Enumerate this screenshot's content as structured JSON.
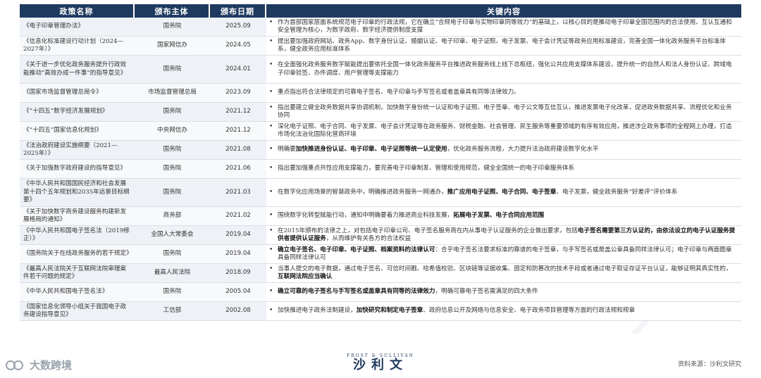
{
  "header": {
    "col_name": "政策名称",
    "col_issuer": "颁布主体",
    "col_date": "颁布日期",
    "col_content": "关键内容"
  },
  "rows": [
    {
      "name": "《电子印章管理办法》",
      "issuer": "国务院",
      "date": "2025.09",
      "content": [
        {
          "t": "作为首部国家层面系统规范电子印章的行政法规，它在确立“合规电子印章与实物印章同等效力”的基础上，以核心目的是推动电子印章全国范围内的合法使用、互认互通和安全管理为核心，为数字政府、数字经济提供制度支撑"
        }
      ]
    },
    {
      "name": "《信息化标准建设行动计划（2024—2027年）》",
      "issuer": "国家网信办",
      "date": "2024.05",
      "content": [
        {
          "t": "提出要加强政府网站、政务App、数字身份认证、婚姻认证、电子印章、电子证照、电子发票、电子会计凭证等政务应用标准建设，完善全国一体化政务服务平台标准体系，健全政务应用标准体系"
        }
      ]
    },
    {
      "name": "《关于进一步优化政务服务提升行政效能推动“高效办成一件事”的指导意见》",
      "issuer": "国务院",
      "date": "2024.01",
      "content": [
        {
          "t": "在全面强化政务服务数字赋能提出要依托全国一体化政务服务平台推进政务服务线上线下总枢纽，强化公共应用支撑体系建设，提升统一的自然人和法人身份认证、跨域电子印章验签、办件调度、用户管理等支撑能力"
        }
      ]
    },
    {
      "name": "《国家市场监督管理总局令》",
      "issuer": "市场监督管理总局",
      "date": "2023.09",
      "content": [
        {
          "t": "重点指出符合法律规定的可靠电子签名、电子印章与手写签名或者盖章具有同等法律效力。"
        }
      ]
    },
    {
      "name": "《“十四五”数字经济发展规划》",
      "issuer": "国务院",
      "date": "2021.12",
      "content": [
        {
          "t": "指出要建立健全政务数据共享协调机制，加快数字身份统一认证和电子证照、电子签章、电子公文等互信互认，推进发票电子化改革，促进政务数据共享、流程优化和业务协同"
        }
      ]
    },
    {
      "name": "《“十四五”国家信息化规划》",
      "issuer": "中央网信办",
      "date": "2021.12",
      "content": [
        {
          "t": "深化电子证照、电子合同、电子发票、电子会计凭证等在政务服务、财税金融、社会管理、民生服务等重要领域的有序有效应用，推进涉企政务事项的全程网上办理，打造市场化法治化国际化营商环境"
        }
      ]
    },
    {
      "name": "《法治政府建设实施纲要（2021—2025年）》",
      "issuer": "国务院",
      "date": "2021.08",
      "content": [
        {
          "t": "明确要"
        },
        {
          "t": "加快推进身份认证、电子印章、电子证照等统一认定使用",
          "b": true
        },
        {
          "t": "，优化政务服务流程，大力提升法治政府建设数字化水平"
        }
      ]
    },
    {
      "name": "《关于加强数字政府建设的指导意见》",
      "issuer": "国务院",
      "date": "2021.06",
      "content": [
        {
          "t": "指出要加强重点共性应用支撑能力，要完善电子印章制发、管理和使用规范，健全全国统一的电子印章服务体系"
        }
      ]
    },
    {
      "name": "《中华人民共和国国民经济和社会发展第十四个五年规划和2035年远景目标纲要》",
      "issuer": "国务院",
      "date": "2021.03",
      "content": [
        {
          "t": "在数字化应用场景的智慧政务中，明确推进政务服务一网通办，"
        },
        {
          "t": "推广应用电子证照、电子合同、电子签章",
          "b": true
        },
        {
          "t": "、电子发票，健全政务服务“好差评”评价体系"
        }
      ]
    },
    {
      "name": "《关于加快数字商务建设服务构建新发展格局的通知》",
      "issuer": "商务部",
      "date": "2021.02",
      "content": [
        {
          "t": "围绕数字化转型赋能行动，通知中明确要着力推进商业科技发展，"
        },
        {
          "t": "拓展电子发票、电子合同应用范围",
          "b": true
        }
      ]
    },
    {
      "name": "《中华人民共和国电子签名法（2019修正）》",
      "issuer": "全国人大常委会",
      "date": "2019.04",
      "content": [
        {
          "t": "在2015年颁布的法律之上，对包括电子印章公司、电子签名服务商在内从事电子认证服务的企业做出要求，包括"
        },
        {
          "t": "电子签名需要第三方认证的，由依法设立的电子认证服务提供者提供认证服务",
          "b": true
        },
        {
          "t": "，从而维护有关各方的合法权益"
        }
      ]
    },
    {
      "name": "《国务院关于在线政务服务的若干规定》",
      "issuer": "国务院",
      "date": "2019.04",
      "content": [
        {
          "t": "确立电子签名、电子印章、电子证照、档案资料的法律认可",
          "b": true
        },
        {
          "t": "：合乎电子签名法要求标准的靠谱的电子签章，与手写签名或是盖公章具备同样法律认可；电子印章与两面图章具备同样法律认可"
        }
      ]
    },
    {
      "name": "《最高人民法院关于互联网法院审理案件若干问题的规定》",
      "issuer": "最高人民法院",
      "date": "2018.09",
      "content": [
        {
          "t": "当事人提交的电子数据，通过电子签名、可信时间戳、哈希值校验、区块链等证据收集、固定和防篡改的技术手段或者通过电子取证存证平台认证，能够证明其真实性的，"
        },
        {
          "t": "互联网法院应当确认",
          "b": true
        }
      ]
    },
    {
      "name": "《中华人民共和国电子签名法》",
      "issuer": "国务院",
      "date": "2005.04",
      "content": [
        {
          "t": "确立可靠的电子签名与手写签名或盖章具有同等的法律效力",
          "b": true
        },
        {
          "t": "，明确可靠电子签名需满足的四大条件"
        }
      ]
    },
    {
      "name": "《国家信息化领导小组关于我国电子政务建设指导意见》",
      "issuer": "工信部",
      "date": "2002.08",
      "content": [
        {
          "t": "加快推进电子政务法制建设，"
        },
        {
          "t": "加快研究和制定电子签章",
          "b": true
        },
        {
          "t": "、政府信息公开及网络与信息安全、电子政务项目管理等方面的行政法规和规章"
        }
      ]
    }
  ],
  "footer": {
    "left_brand": "大数跨境",
    "center_small": "FROST & SULLIVAN",
    "center_big": "沙利文",
    "source": "资料来源：沙利文研究"
  },
  "bullet_symbol": "•",
  "colors": {
    "header_bg": "#1f3a5f",
    "row_odd": "#eef2f7",
    "row_even": "#f7f9fb"
  }
}
